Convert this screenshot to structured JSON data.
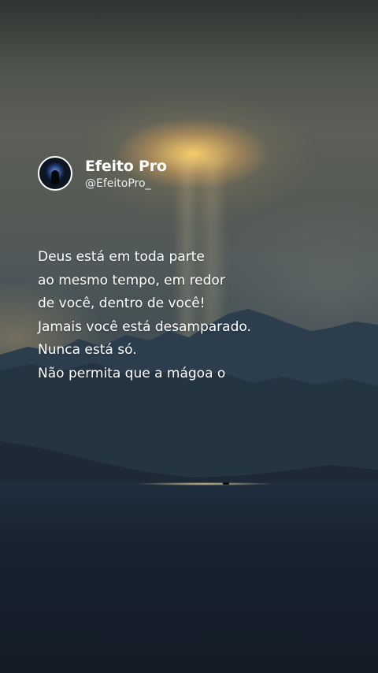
{
  "profile": {
    "display_name": "Efeito Pro",
    "handle": "@EfeitoPro_"
  },
  "quote": {
    "lines": [
      "Deus está em toda parte",
      "ao mesmo tempo, em redor",
      "de você, dentro de você!",
      "Jamais você está desamparado.",
      "Nunca está só.",
      "Não permita que a mágoa o"
    ]
  }
}
